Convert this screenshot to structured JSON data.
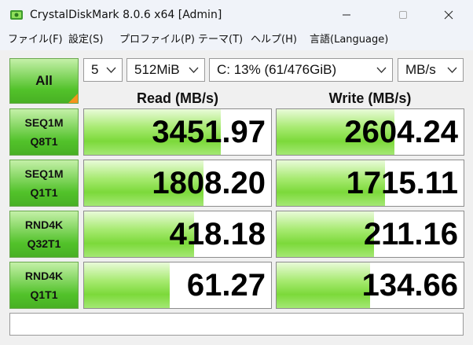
{
  "window": {
    "title": "CrystalDiskMark 8.0.6 x64 [Admin]"
  },
  "menu": [
    {
      "label": "ファイル(F)"
    },
    {
      "label": "設定(S)"
    },
    {
      "label": "プロファイル(P)"
    },
    {
      "label": "テーマ(T)"
    },
    {
      "label": "ヘルプ(H)"
    },
    {
      "label": "言語(Language)"
    }
  ],
  "toolbar": {
    "all_label": "All",
    "count": "5",
    "size": "512MiB",
    "drive": "C: 13% (61/476GiB)",
    "unit": "MB/s"
  },
  "headers": {
    "read": "Read (MB/s)",
    "write": "Write (MB/s)"
  },
  "tests": [
    {
      "line1": "SEQ1M",
      "line2": "Q8T1",
      "read": "3451.97",
      "read_fill": 0.73,
      "write": "2604.24",
      "write_fill": 0.63
    },
    {
      "line1": "SEQ1M",
      "line2": "Q1T1",
      "read": "1808.20",
      "read_fill": 0.64,
      "write": "1715.11",
      "write_fill": 0.58
    },
    {
      "line1": "RND4K",
      "line2": "Q32T1",
      "read": "418.18",
      "read_fill": 0.59,
      "write": "211.16",
      "write_fill": 0.52
    },
    {
      "line1": "RND4K",
      "line2": "Q1T1",
      "read": "61.27",
      "read_fill": 0.46,
      "write": "134.66",
      "write_fill": 0.5
    }
  ],
  "comment": {
    "value": ""
  },
  "colors": {
    "button_green": "#52c22a",
    "bar_green": "#7cd93a",
    "corner_orange": "#f5941d"
  }
}
